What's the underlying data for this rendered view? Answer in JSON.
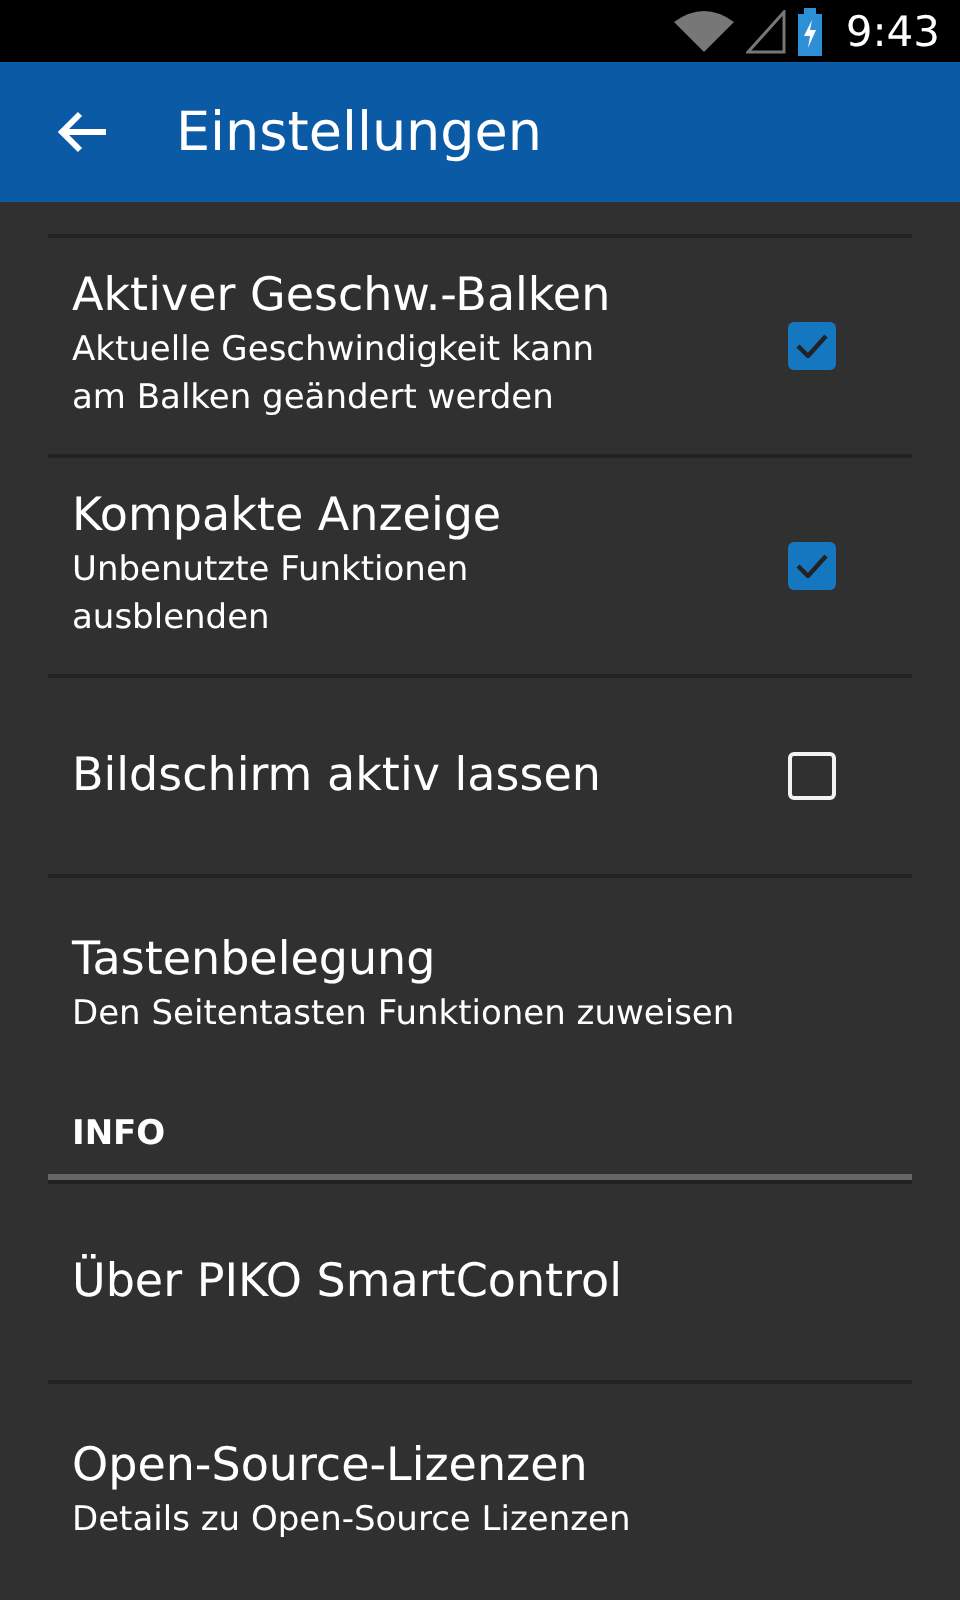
{
  "status_bar": {
    "time": "9:43"
  },
  "app_bar": {
    "title": "Einstellungen"
  },
  "items": [
    {
      "kind": "checkbox",
      "title": "Aktiver Geschw.-Balken",
      "summary": "Aktuelle Geschwindigkeit kann am Balken geändert werden",
      "checked": true
    },
    {
      "kind": "checkbox",
      "title": "Kompakte Anzeige",
      "summary": "Unbenutzte Funktionen ausblenden",
      "checked": true
    },
    {
      "kind": "checkbox",
      "title": "Bildschirm aktiv lassen",
      "checked": false
    },
    {
      "kind": "plain",
      "title": "Tastenbelegung",
      "summary": "Den Seitentasten Funktionen zuweisen"
    },
    {
      "kind": "header",
      "title": "INFO"
    },
    {
      "kind": "plain",
      "title": "Über PIKO SmartControl"
    },
    {
      "kind": "plain",
      "title": "Open-Source-Lizenzen",
      "summary": "Details zu Open-Source Lizenzen"
    }
  ]
}
